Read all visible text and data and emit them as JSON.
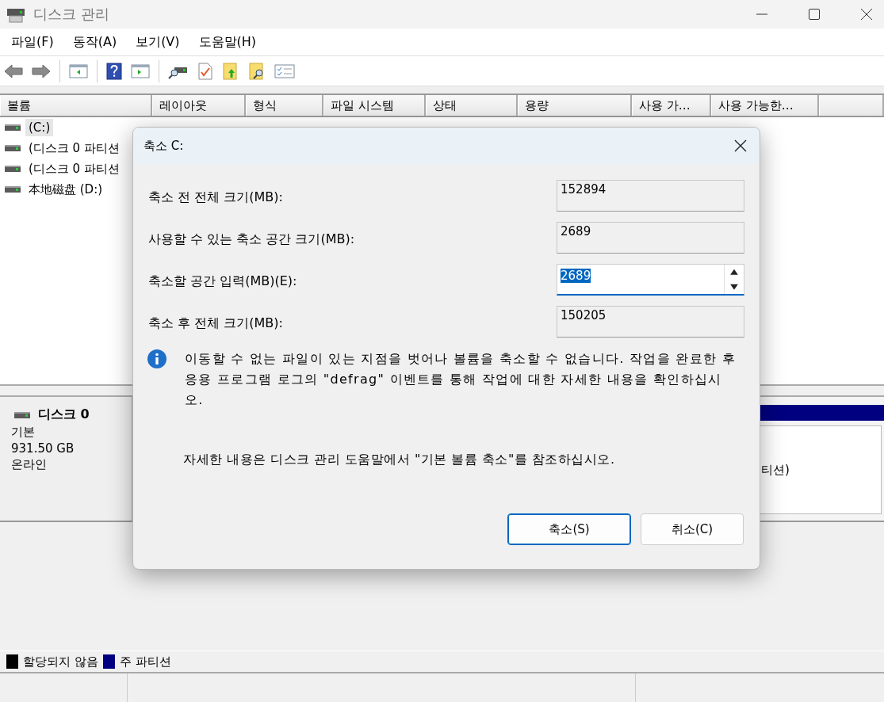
{
  "window": {
    "title": "디스크 관리"
  },
  "menu": [
    "파일(F)",
    "동작(A)",
    "보기(V)",
    "도움말(H)"
  ],
  "volume_table": {
    "columns": [
      "볼륨",
      "레이아웃",
      "형식",
      "파일 시스템",
      "상태",
      "용량",
      "사용 가…",
      "사용 가능한…"
    ],
    "rows": [
      {
        "cells": [
          "(C:)"
        ],
        "selected": true
      },
      {
        "cells": [
          "(디스크 0 파티션"
        ],
        "selected": false
      },
      {
        "cells": [
          "(디스크 0 파티션"
        ],
        "selected": false
      },
      {
        "cells": [
          "本地磁盘 (D:)"
        ],
        "selected": false
      }
    ]
  },
  "disk_pane": {
    "name": "디스크 0",
    "type": "기본",
    "size": "931.50 GB",
    "status": "온라인",
    "partition_text": "티션)"
  },
  "legend": [
    {
      "label": "할당되지 않음",
      "color": "#000000"
    },
    {
      "label": "주 파티션",
      "color": "#000080"
    }
  ],
  "dialog": {
    "title": "축소 C:",
    "fields": [
      {
        "label": "축소 전 전체 크기(MB):",
        "value": "152894",
        "kind": "readonly"
      },
      {
        "label": "사용할 수 있는 축소 공간 크기(MB):",
        "value": "2689",
        "kind": "readonly"
      },
      {
        "label": "축소할 공간 입력(MB)(E):",
        "value": "2689",
        "kind": "spin",
        "text_selected": true
      },
      {
        "label": "축소 후 전체 크기(MB):",
        "value": "150205",
        "kind": "readonly"
      }
    ],
    "info": "이동할 수 없는 파일이 있는 지점을 벗어나 볼륨을 축소할 수 없습니다. 작업을 완료한 후 응용 프로그램 로그의 \"defrag\" 이벤트를 통해 작업에 대한 자세한 내용을 확인하십시오.",
    "help": "자세한 내용은 디스크 관리 도움말에서 \"기본 볼륨 축소\"를 참조하십시오.",
    "buttons": [
      {
        "label": "축소(S)",
        "default": true
      },
      {
        "label": "취소(C)",
        "default": false
      }
    ]
  }
}
